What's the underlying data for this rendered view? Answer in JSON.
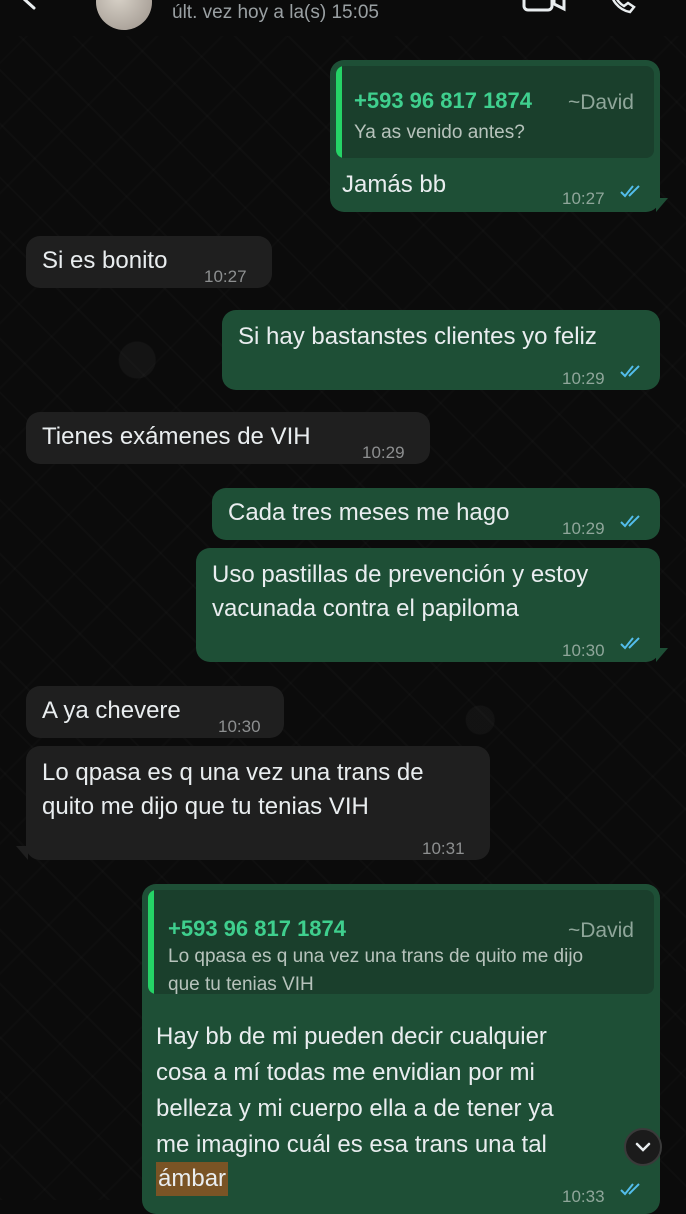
{
  "header": {
    "last_seen": "últ. vez hoy a la(s) 15:05"
  },
  "icons": [
    "back-arrow-icon",
    "avatar",
    "video-call-icon",
    "phone-icon",
    "double-check-icon",
    "chevron-down-icon"
  ],
  "colors": {
    "outgoing_bubble": "#1e4f36",
    "incoming_bubble": "#1f1f1f",
    "quote_accent": "#25d366",
    "read_ticks": "#53bdeb",
    "highlight": "#7a5425"
  },
  "messages": [
    {
      "direction": "out",
      "quote": {
        "number": "+593 96 817 1874",
        "name": "~David",
        "text": "Ya as venido antes?"
      },
      "text": "Jamás bb",
      "time": "10:27",
      "read": true
    },
    {
      "direction": "in",
      "text": "Si es bonito",
      "time": "10:27"
    },
    {
      "direction": "out",
      "text": "Si hay bastanstes clientes yo feliz",
      "time": "10:29",
      "read": true
    },
    {
      "direction": "in",
      "text": "Tienes exámenes de VIH",
      "time": "10:29"
    },
    {
      "direction": "out",
      "text": "Cada tres meses me hago",
      "time": "10:29",
      "read": true
    },
    {
      "direction": "out",
      "lines": [
        "Uso pastillas de prevención y estoy",
        "vacunada contra el papiloma"
      ],
      "time": "10:30",
      "read": true
    },
    {
      "direction": "in",
      "text": "A ya chevere",
      "time": "10:30"
    },
    {
      "direction": "in",
      "lines": [
        "Lo qpasa es q una vez una trans de",
        "quito me dijo que tu tenias VIH"
      ],
      "time": "10:31"
    },
    {
      "direction": "out",
      "quote": {
        "number": "+593 96 817 1874",
        "name": "~David",
        "lines": [
          "Lo qpasa es q una vez una trans de quito me dijo",
          "que tu tenias VIH"
        ]
      },
      "lines": [
        "Hay bb de mi pueden decir cualquier",
        "cosa a mí todas me envidian por mi",
        "belleza y mi cuerpo ella a de tener ya",
        "me imagino cuál es esa trans una tal"
      ],
      "highlighted_word": "ámbar",
      "time": "10:33",
      "read": true
    }
  ]
}
